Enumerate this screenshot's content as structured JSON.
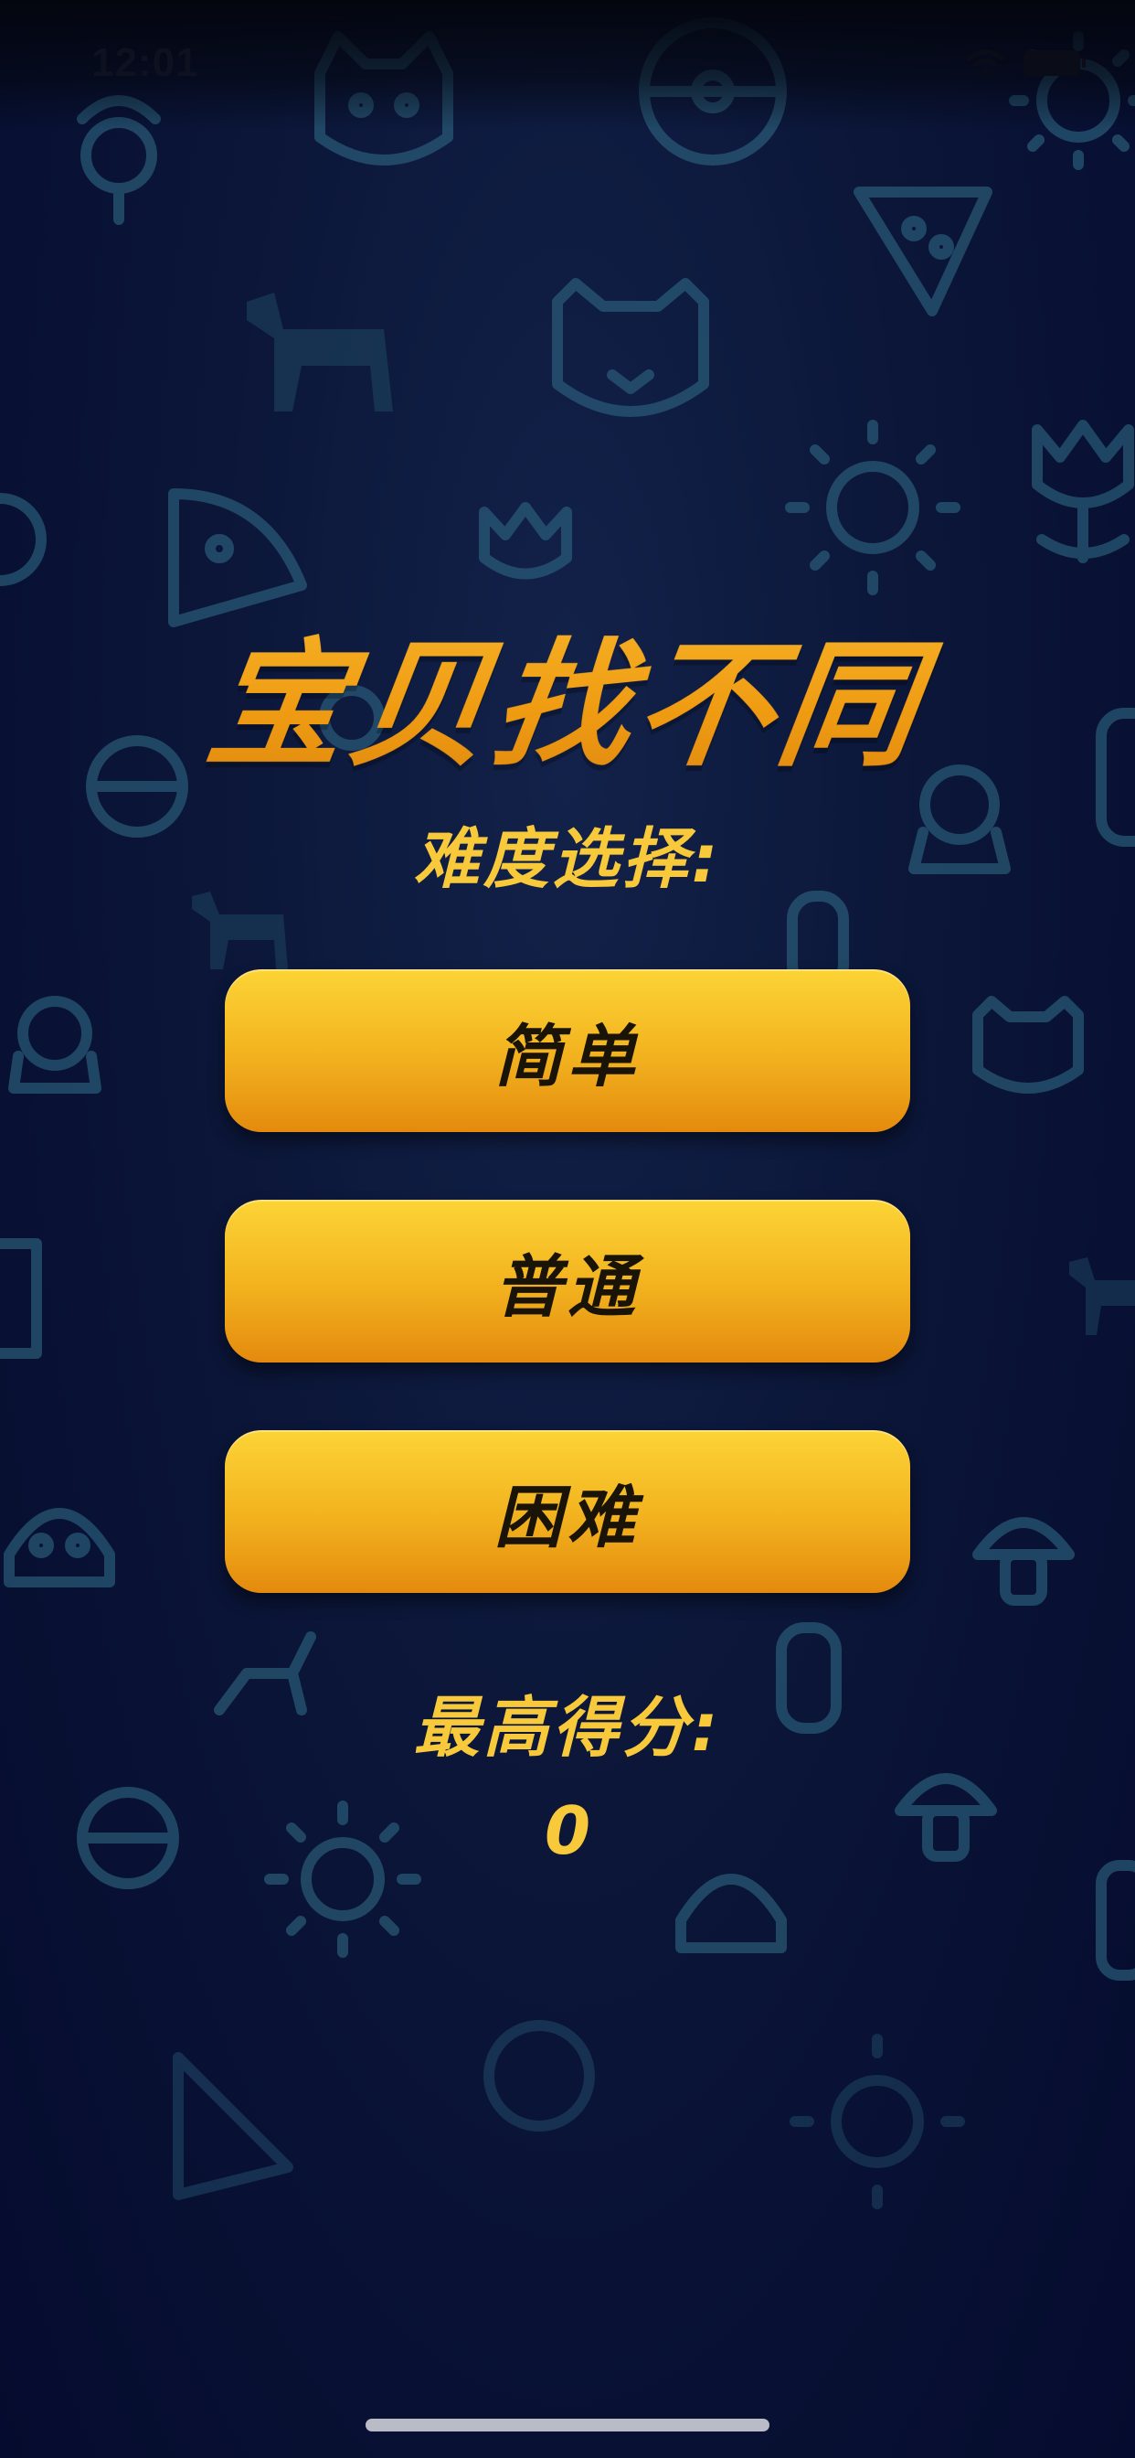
{
  "status_bar": {
    "time": "12:01",
    "icons": [
      "wifi-icon",
      "battery-icon"
    ]
  },
  "title": "宝贝找不同",
  "difficulty": {
    "label": "难度选择:",
    "options": [
      "简单",
      "普通",
      "困难"
    ]
  },
  "best_score": {
    "label": "最高得分:",
    "value": "0"
  },
  "colors": {
    "background": "#0b1638",
    "accent": "#f2b11e",
    "title": "#ef9b12",
    "label": "#f7c93b",
    "button_text": "#1a1408",
    "background_icons": "#2a5d7a"
  },
  "background_icons": [
    "flower-icon",
    "cat-icon",
    "ball-icon",
    "sun-icon",
    "pizza-icon",
    "horse-icon",
    "tulip-icon",
    "tiger-icon",
    "robot-icon",
    "crab-icon",
    "mushroom-icon",
    "bottle-icon",
    "deer-icon"
  ]
}
